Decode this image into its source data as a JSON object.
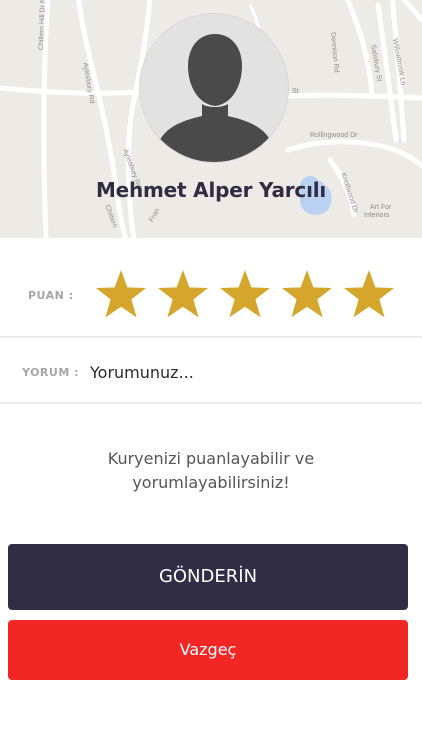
{
  "header": {
    "map_labels": {
      "aylesbury": "Aylesbury Rd",
      "chiltern_hill": "Chiltern Hill Dr N",
      "aylesbury_lower": "Aylesbury Rd",
      "chiltern": "Chiltern",
      "fran": "Fran",
      "dennison": "Dennison Rd",
      "salisbury": "Salisbury St",
      "willowbrook": "Willowbrook Ln",
      "st": "St",
      "rollingwood": "Rollingwood Dr",
      "knollwood": "Knollwood Dr",
      "art_for": "Art For",
      "interiors": "Interiors"
    },
    "courier_name": "Mehmet Alper Yarcılı"
  },
  "rating": {
    "label": "PUAN :",
    "value": 5,
    "max": 5,
    "star_color": "#d4a72c"
  },
  "comment": {
    "label": "YORUM :",
    "placeholder": "Yorumunuz..."
  },
  "info_text": "Kuryenizi puanlayabilir ve yorumlayabilirsiniz!",
  "actions": {
    "submit_label": "GÖNDERİN",
    "submit_color": "#302d45",
    "cancel_label": "Vazgeç",
    "cancel_color": "#f32626"
  }
}
